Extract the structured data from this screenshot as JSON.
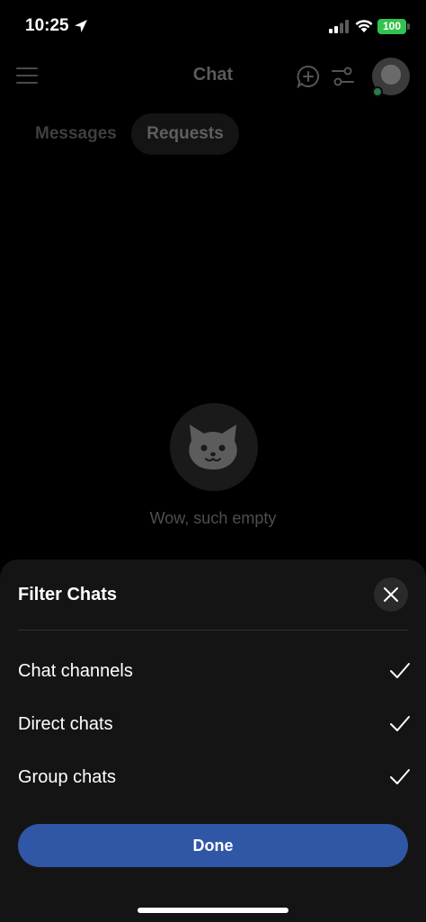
{
  "status_bar": {
    "time": "10:25",
    "battery": "100"
  },
  "header": {
    "title": "Chat",
    "menu_icon": "hamburger-menu-icon",
    "new_chat_icon": "add-chat-bubble-icon",
    "filter_icon": "filter-sliders-icon"
  },
  "tabs": [
    {
      "label": "Messages",
      "selected": false
    },
    {
      "label": "Requests",
      "selected": true
    }
  ],
  "empty_state": {
    "icon": "cat-face-icon",
    "text": "Wow, such empty"
  },
  "filter_sheet": {
    "title": "Filter Chats",
    "options": [
      {
        "label": "Chat channels",
        "checked": true
      },
      {
        "label": "Direct chats",
        "checked": true
      },
      {
        "label": "Group chats",
        "checked": true
      }
    ],
    "done_label": "Done"
  },
  "colors": {
    "accent": "#3056a6",
    "sheet_background": "#141414",
    "battery": "#33c24d"
  }
}
